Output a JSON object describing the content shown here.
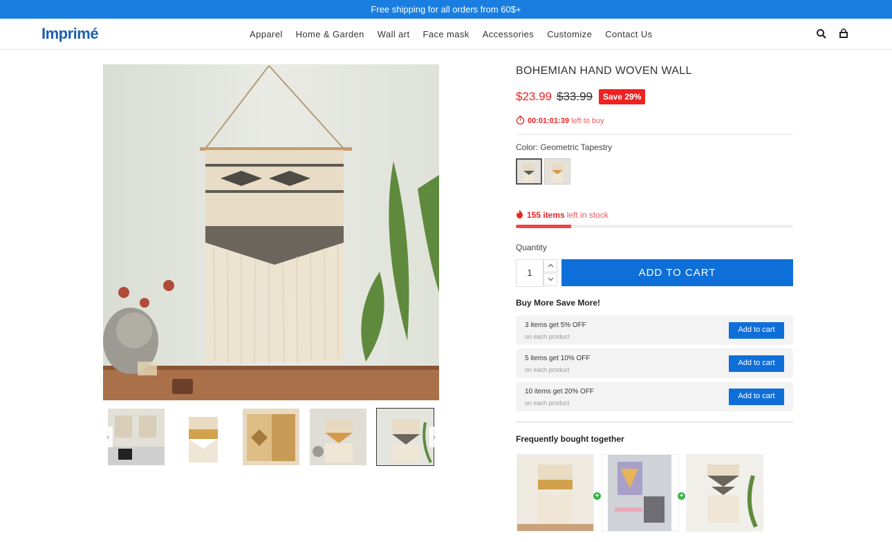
{
  "topbar": {
    "text": "Free shipping for all orders from 60$+"
  },
  "header": {
    "logo": "Imprimé",
    "nav": [
      "Apparel",
      "Home & Garden",
      "Wall art",
      "Face mask",
      "Accessories",
      "Customize",
      "Contact Us"
    ]
  },
  "product": {
    "title": "BOHEMIAN HAND WOVEN WALL",
    "price": "$23.99",
    "old_price": "$33.99",
    "save_badge": "Save 29%",
    "timer_value": "00:01:01:39",
    "timer_suffix": "left to buy",
    "color_label": "Color: Geometric Tapestry",
    "stock_count": "155 items",
    "stock_suffix": "left in stock",
    "stock_fill_fraction": 0.2,
    "quantity_label": "Quantity",
    "quantity_value": "1",
    "add_to_cart": "ADD TO CART"
  },
  "bulk": {
    "title": "Buy More Save More!",
    "tiers": [
      {
        "label": "3 items get 5% OFF",
        "sub": "on each product",
        "button": "Add to cart"
      },
      {
        "label": "5 items get 10% OFF",
        "sub": "on each product",
        "button": "Add to cart"
      },
      {
        "label": "10 items get 20% OFF",
        "sub": "on each product",
        "button": "Add to cart"
      }
    ]
  },
  "fbt": {
    "title": "Frequently bought together"
  },
  "colors": {
    "accent": "#0f6fd9",
    "topbar": "#1a7ee0",
    "sale": "#e22222",
    "plus": "#3bb34a"
  }
}
